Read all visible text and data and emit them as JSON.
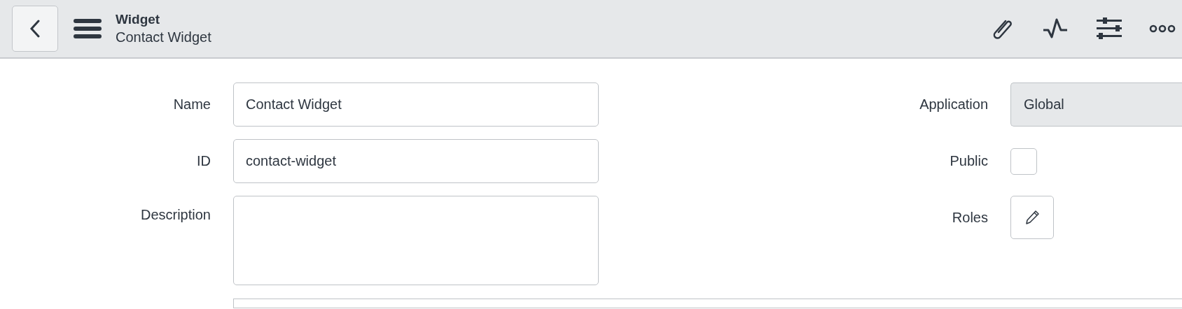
{
  "header": {
    "title": "Widget",
    "subtitle": "Contact Widget"
  },
  "form_left": [
    {
      "kind": "input",
      "label": "Name",
      "value": "Contact Widget"
    },
    {
      "kind": "input",
      "label": "ID",
      "value": "contact-widget"
    },
    {
      "kind": "textarea",
      "label": "Description"
    }
  ],
  "form_right": [
    {
      "kind": "readonly",
      "label": "Application",
      "value": "Global"
    },
    {
      "kind": "checkbox",
      "label": "Public",
      "checked": false
    },
    {
      "kind": "edit-button",
      "label": "Roles"
    }
  ]
}
